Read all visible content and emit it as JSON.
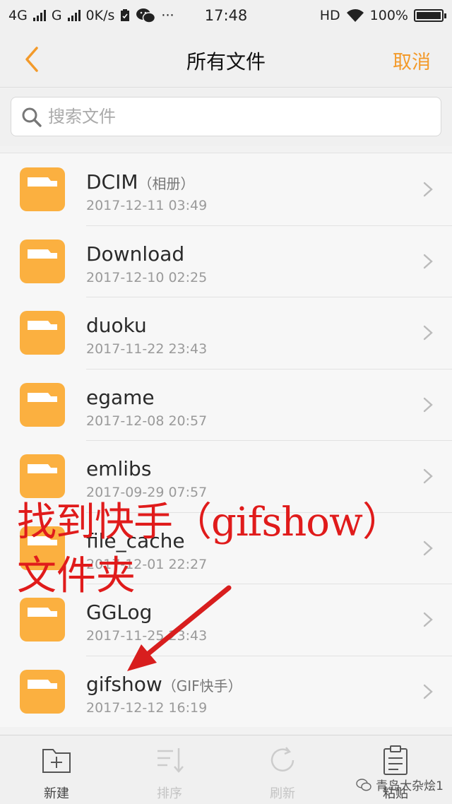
{
  "status_bar": {
    "network1": "4G",
    "network2": "G",
    "speed": "0K/s",
    "more": "···",
    "time": "17:48",
    "hd": "HD",
    "battery": "100%"
  },
  "nav": {
    "title": "所有文件",
    "cancel": "取消"
  },
  "search": {
    "placeholder": "搜索文件"
  },
  "files": [
    {
      "name": "DCIM",
      "alias": "（相册）",
      "date": "2017-12-11 03:49"
    },
    {
      "name": "Download",
      "alias": "",
      "date": "2017-12-10 02:25"
    },
    {
      "name": "duoku",
      "alias": "",
      "date": "2017-11-22 23:43"
    },
    {
      "name": "egame",
      "alias": "",
      "date": "2017-12-08 20:57"
    },
    {
      "name": "emlibs",
      "alias": "",
      "date": "2017-09-29 07:57"
    },
    {
      "name": "file_cache",
      "alias": "",
      "date": "2017-12-01 22:27"
    },
    {
      "name": "GGLog",
      "alias": "",
      "date": "2017-11-25 23:43"
    },
    {
      "name": "gifshow",
      "alias": "（GIF快手）",
      "date": "2017-12-12 16:19"
    }
  ],
  "annotation": {
    "line1": "找到快手（gifshow）",
    "line2": "文件夹",
    "color": "#e01b1b"
  },
  "toolbar": {
    "new": "新建",
    "sort": "排序",
    "refresh": "刷新",
    "paste": "粘贴"
  },
  "watermark": "青岛大杂烩1",
  "colors": {
    "accent": "#f39a2a",
    "folder": "#fbb040"
  }
}
